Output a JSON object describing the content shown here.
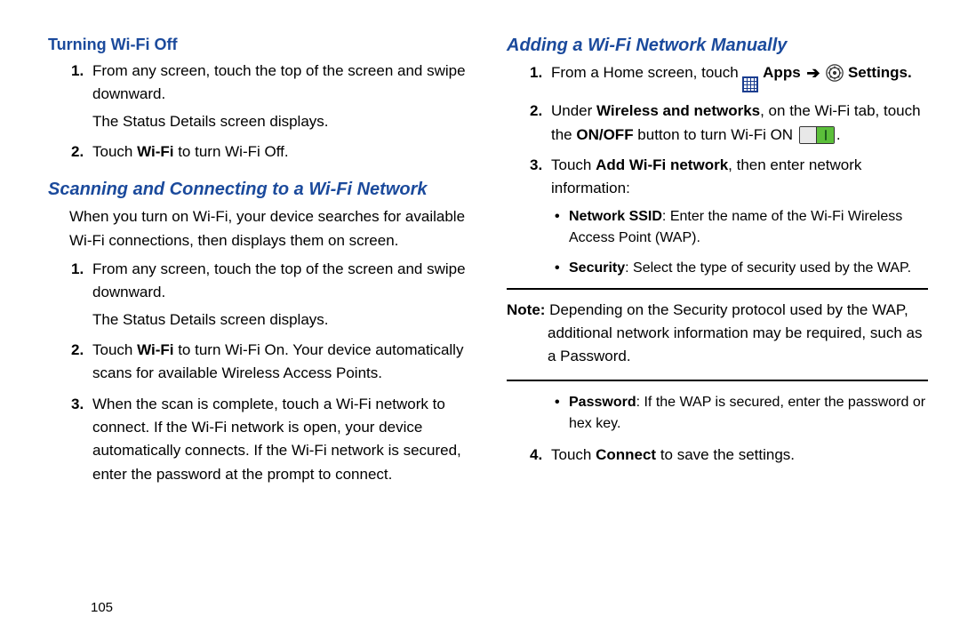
{
  "page_number": "105",
  "left": {
    "heading_off": "Turning Wi-Fi Off",
    "off_step1_a": "From any screen, touch the top of the screen and swipe downward.",
    "off_step1_b": "The Status Details screen displays.",
    "off_step2_a": "Touch ",
    "off_step2_b": "Wi-Fi",
    "off_step2_c": " to turn Wi-Fi Off.",
    "heading_scan": "Scanning and Connecting to a Wi-Fi Network",
    "scan_intro": "When you turn on Wi-Fi, your device searches for available Wi-Fi connections, then displays them on screen.",
    "scan_step1_a": "From any screen, touch the top of the screen and swipe downward.",
    "scan_step1_b": "The Status Details screen displays.",
    "scan_step2_a": "Touch ",
    "scan_step2_b": "Wi-Fi",
    "scan_step2_c": " to turn Wi-Fi On. Your device automatically scans for available Wireless Access Points.",
    "scan_step3": "When the scan is complete, touch a Wi-Fi network to connect. If the Wi-Fi network is open, your device automatically connects. If the Wi-Fi network is secured, enter the password at the prompt to connect."
  },
  "right": {
    "heading_add": "Adding a Wi-Fi Network Manually",
    "add_step1_a": "From a Home screen, touch ",
    "add_step1_apps": " Apps ",
    "add_step1_settings": " Settings.",
    "add_step2_a": "Under ",
    "add_step2_b": "Wireless and networks",
    "add_step2_c": ", on the Wi-Fi tab, touch the ",
    "add_step2_d": "ON/OFF",
    "add_step2_e": " button to turn Wi-Fi ON ",
    "add_step2_f": ".",
    "add_step3_a": "Touch ",
    "add_step3_b": "Add Wi-Fi network",
    "add_step3_c": ", then enter network information:",
    "bul_ssid_a": "Network SSID",
    "bul_ssid_b": ": Enter the name of the Wi-Fi Wireless Access Point (WAP).",
    "bul_sec_a": "Security",
    "bul_sec_b": ": Select the type of security used by the WAP.",
    "note_label": "Note:",
    "note_body": " Depending on the Security protocol used by the WAP, additional network information may be required, such as a Password.",
    "bul_pw_a": "Password",
    "bul_pw_b": ": If the WAP is secured, enter the password or hex key.",
    "add_step4_a": "Touch ",
    "add_step4_b": "Connect",
    "add_step4_c": " to save the settings."
  }
}
